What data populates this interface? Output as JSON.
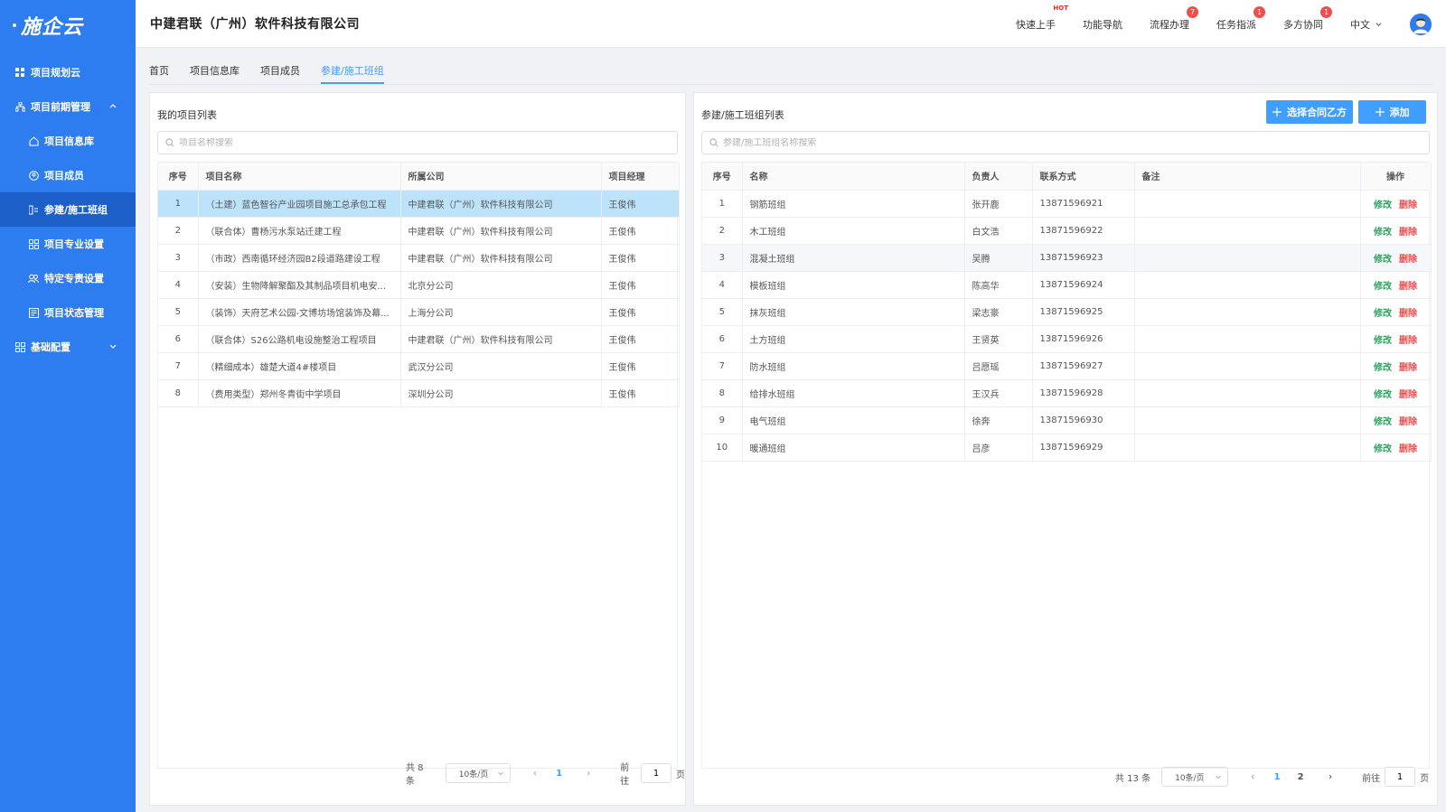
{
  "sidebar": {
    "logo": "施企云",
    "items": [
      {
        "label": "项目规划云"
      },
      {
        "label": "项目前期管理"
      },
      {
        "label": "项目信息库"
      },
      {
        "label": "项目成员"
      },
      {
        "label": "参建/施工班组"
      },
      {
        "label": "项目专业设置"
      },
      {
        "label": "特定专责设置"
      },
      {
        "label": "项目状态管理"
      },
      {
        "label": "基础配置"
      }
    ]
  },
  "header": {
    "company": "中建君联（广州）软件科技有限公司",
    "nav": [
      {
        "label": "快速上手",
        "hot": "HOT"
      },
      {
        "label": "功能导航"
      },
      {
        "label": "流程办理",
        "badge": "7"
      },
      {
        "label": "任务指派",
        "badge": "1"
      },
      {
        "label": "多方协同",
        "badge": "1"
      }
    ],
    "lang": "中文"
  },
  "tabs": [
    "首页",
    "项目信息库",
    "项目成员",
    "参建/施工班组"
  ],
  "left": {
    "title": "我的项目列表",
    "search_placeholder": "项目名称搜索",
    "columns": [
      "序号",
      "项目名称",
      "所属公司",
      "项目经理"
    ],
    "rows": [
      [
        "1",
        "（土建）蓝色智谷产业园项目施工总承包工程",
        "中建君联（广州）软件科技有限公司",
        "王俊伟"
      ],
      [
        "2",
        "（联合体）曹杨污水泵站迁建工程",
        "中建君联（广州）软件科技有限公司",
        "王俊伟"
      ],
      [
        "3",
        "（市政）西南循环经济园B2段道路建设工程",
        "中建君联（广州）软件科技有限公司",
        "王俊伟"
      ],
      [
        "4",
        "（安装）生物降解聚酯及其制品项目机电安...",
        "北京分公司",
        "王俊伟"
      ],
      [
        "5",
        "（装饰）天府艺术公园-文博坊场馆装饰及幕...",
        "上海分公司",
        "王俊伟"
      ],
      [
        "6",
        "（联合体）S26公路机电设施整治工程项目",
        "中建君联（广州）软件科技有限公司",
        "王俊伟"
      ],
      [
        "7",
        "（精细成本）雄楚大道4#楼项目",
        "武汉分公司",
        "王俊伟"
      ],
      [
        "8",
        "（费用类型）郑州冬青街中学项目",
        "深圳分公司",
        "王俊伟"
      ]
    ],
    "pager": {
      "total": "共 8 条",
      "size": "10条/页",
      "pages": [
        "1"
      ],
      "goto_label": "前往",
      "goto_value": "1",
      "goto_suffix": "页"
    }
  },
  "right": {
    "title": "参建/施工班组列表",
    "btn_select": "选择合同乙方",
    "btn_add": "添加",
    "search_placeholder": "参建/施工班组名称搜索",
    "columns": [
      "序号",
      "名称",
      "负责人",
      "联系方式",
      "备注",
      "操作"
    ],
    "edit_label": "修改",
    "delete_label": "删除",
    "rows": [
      [
        "1",
        "钢筋班组",
        "张开鹿",
        "13871596921",
        ""
      ],
      [
        "2",
        "木工班组",
        "白文浩",
        "13871596922",
        ""
      ],
      [
        "3",
        "混凝土班组",
        "吴腾",
        "13871596923",
        ""
      ],
      [
        "4",
        "模板班组",
        "陈高华",
        "13871596924",
        ""
      ],
      [
        "5",
        "抹灰班组",
        "梁志豪",
        "13871596925",
        ""
      ],
      [
        "6",
        "土方班组",
        "王贤英",
        "13871596926",
        ""
      ],
      [
        "7",
        "防水班组",
        "吕愿瑶",
        "13871596927",
        ""
      ],
      [
        "8",
        "给排水班组",
        "王汉兵",
        "13871596928",
        ""
      ],
      [
        "9",
        "电气班组",
        "徐奔",
        "13871596930",
        ""
      ],
      [
        "10",
        "暖通班组",
        "吕彦",
        "13871596929",
        ""
      ]
    ],
    "pager": {
      "total": "共 13 条",
      "size": "10条/页",
      "pages": [
        "1",
        "2"
      ],
      "goto_label": "前往",
      "goto_value": "1",
      "goto_suffix": "页"
    }
  }
}
